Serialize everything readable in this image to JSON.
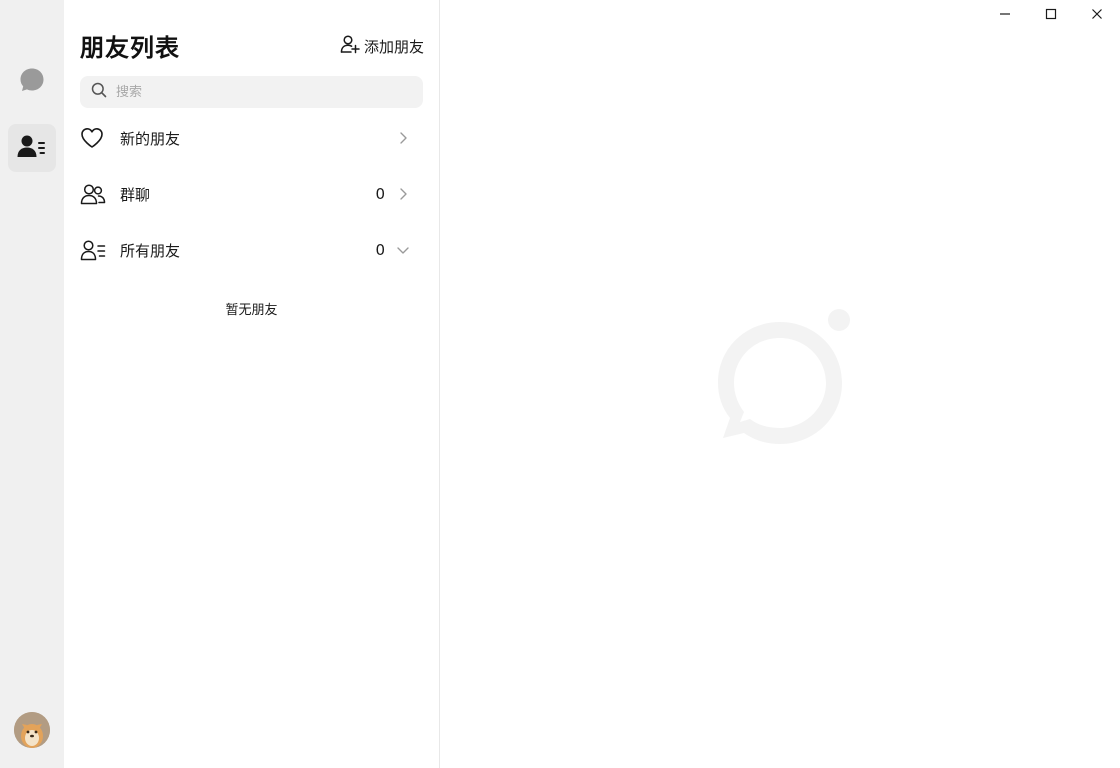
{
  "header": {
    "title": "朋友列表",
    "add_friend_label": "添加朋友"
  },
  "search": {
    "placeholder": "搜索",
    "value": ""
  },
  "rail": {
    "items": [
      {
        "icon": "chat-bubble-icon",
        "active": false
      },
      {
        "icon": "contacts-icon",
        "active": true
      }
    ],
    "avatar": "user-avatar"
  },
  "list": {
    "new_friends": {
      "label": "新的朋友",
      "icon": "heart-icon"
    },
    "group_chats": {
      "label": "群聊",
      "count": "0",
      "icon": "group-icon"
    },
    "all_friends": {
      "label": "所有朋友",
      "count": "0",
      "icon": "contacts-list-icon"
    }
  },
  "empty_message": "暂无朋友",
  "window_controls": {
    "minimize": "minimize-icon",
    "maximize": "maximize-icon",
    "close": "close-icon"
  },
  "colors": {
    "rail_bg": "#f0f0f0",
    "active_bg": "#e6e6e6",
    "search_bg": "#f2f2f2",
    "watermark": "#f3f3f3"
  }
}
